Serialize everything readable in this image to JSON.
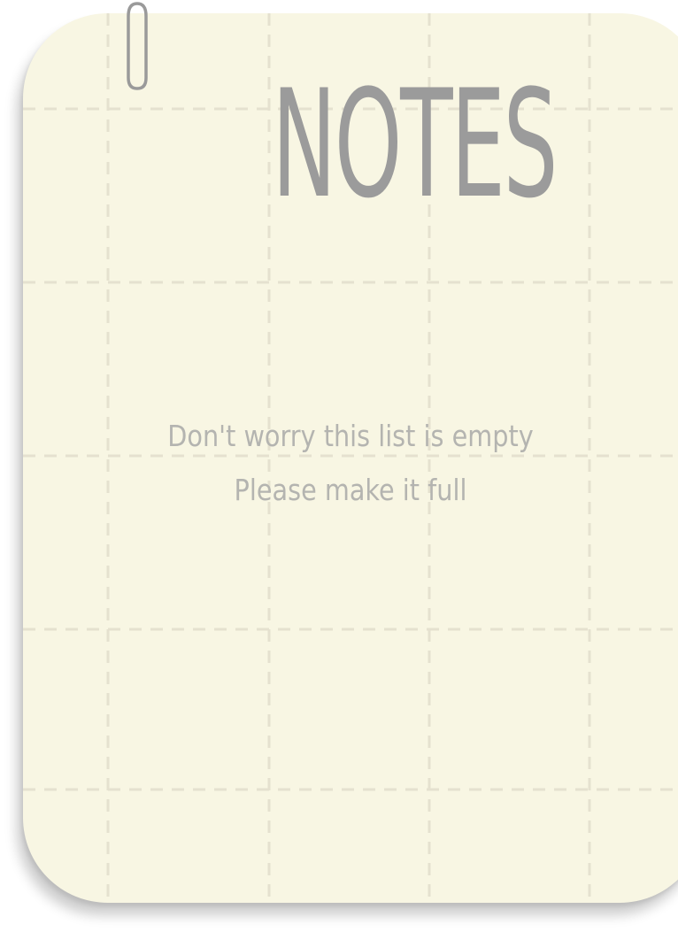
{
  "header": {
    "title": "NOTES"
  },
  "empty_state": {
    "line1": "Don't worry this list is empty",
    "line2": "Please make it full"
  },
  "theme": {
    "paper_color": "#f8f6e3",
    "grid_color": "#e5e1cf",
    "title_color": "#9b9b9b",
    "text_color": "#b4b4b0",
    "clip_color": "#9a9a9a"
  },
  "icons": {
    "clip": "paperclip-icon"
  }
}
